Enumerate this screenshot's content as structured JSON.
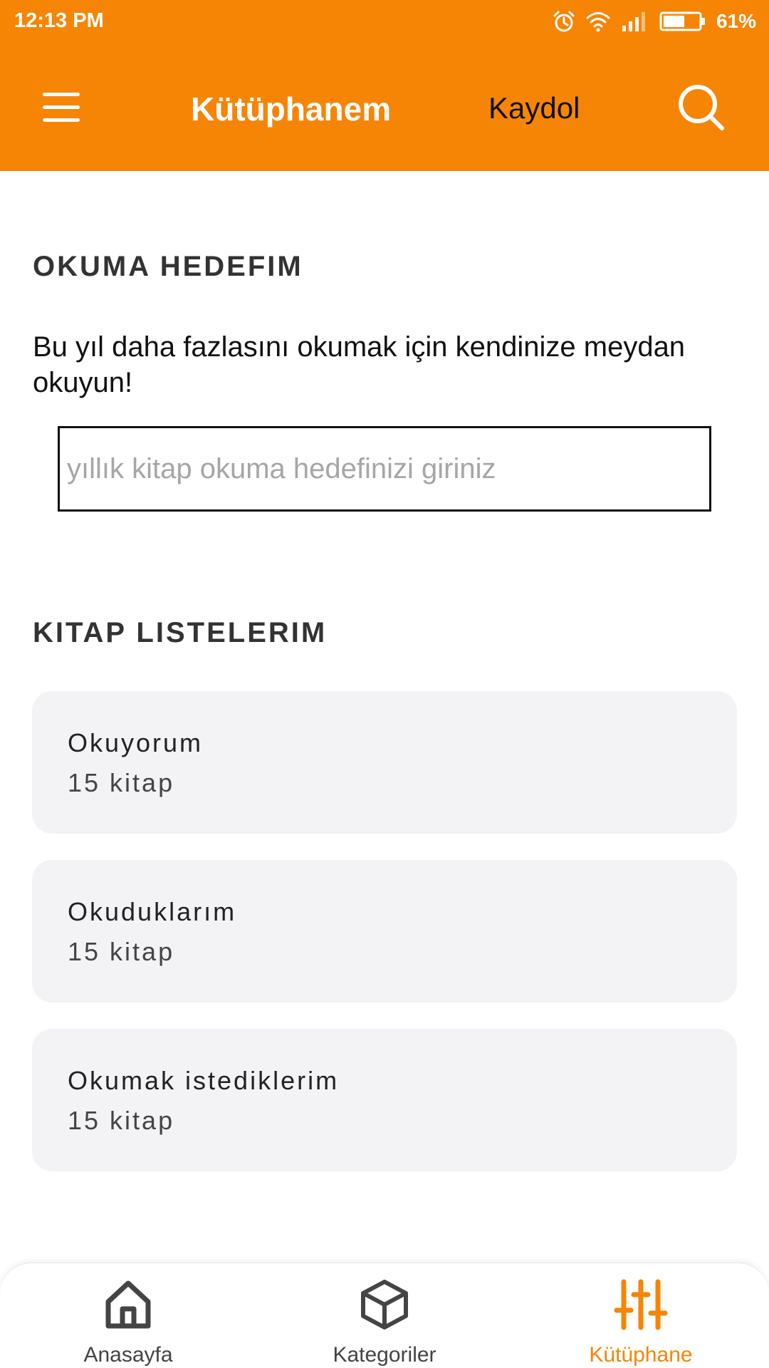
{
  "status_bar": {
    "time": "12:13 PM",
    "battery_percent": "61%",
    "battery_level": 0.61,
    "icons": [
      "alarm-icon",
      "wifi-icon",
      "signal-icon",
      "battery-icon"
    ]
  },
  "toolbar": {
    "title": "Kütüphanem",
    "register_label": "Kaydol",
    "menu_icon": "menu-icon",
    "search_icon": "search-icon"
  },
  "reading_goal": {
    "title": "OKUMA HEDEFIM",
    "description": "Bu yıl daha fazlasını okumak için kendinize meydan okuyun!",
    "input_placeholder": "yıllık kitap okuma hedefinizi giriniz",
    "input_value": ""
  },
  "book_lists": {
    "title": "KITAP LISTELERIM",
    "items": [
      {
        "name": "Okuyorum",
        "count": "15 kitap"
      },
      {
        "name": "Okuduklarım",
        "count": "15 kitap"
      },
      {
        "name": "Okumak istediklerim",
        "count": "15 kitap"
      }
    ]
  },
  "bottom_nav": {
    "items": [
      {
        "label": "Anasayfa",
        "icon": "home-icon",
        "active": false
      },
      {
        "label": "Kategoriler",
        "icon": "cube-icon",
        "active": false
      },
      {
        "label": "Kütüphane",
        "icon": "sliders-icon",
        "active": true
      }
    ]
  },
  "colors": {
    "accent": "#f68506",
    "card_background": "#f3f2f5",
    "text_dark": "#333333",
    "nav_inactive": "#444444"
  }
}
